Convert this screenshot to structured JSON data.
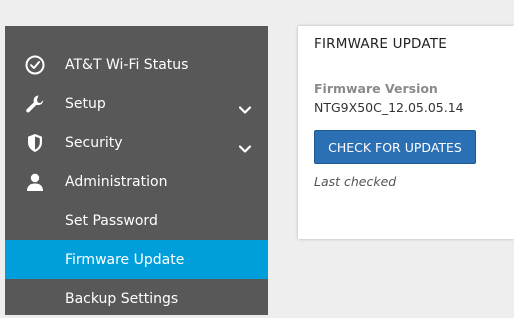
{
  "sidebar": {
    "items": [
      {
        "label": "AT&T Wi-Fi Status",
        "icon": "check-circle-icon",
        "has_chevron": false
      },
      {
        "label": "Setup",
        "icon": "wrench-icon",
        "has_chevron": true
      },
      {
        "label": "Security",
        "icon": "shield-icon",
        "has_chevron": true
      },
      {
        "label": "Administration",
        "icon": "user-icon",
        "has_chevron": false
      },
      {
        "label": "Set Password"
      },
      {
        "label": "Firmware Update",
        "active": true
      },
      {
        "label": "Backup Settings"
      }
    ]
  },
  "card": {
    "title": "FIRMWARE UPDATE",
    "firmware_label": "Firmware Version",
    "firmware_value": "NTG9X50C_12.05.05.14",
    "check_button": "CHECK FOR UPDATES",
    "last_checked": "Last checked"
  },
  "colors": {
    "sidebar_bg": "#585858",
    "active_bg": "#009fdb",
    "button_bg": "#2b70b4",
    "page_bg": "#eeeeee"
  }
}
